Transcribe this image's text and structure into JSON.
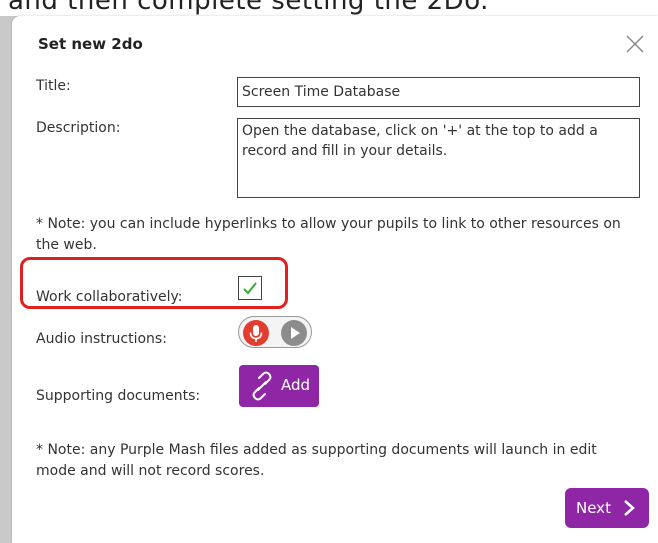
{
  "caption": {
    "text": "and then complete setting the 2Do."
  },
  "dialog": {
    "title": "Set new 2do",
    "close_icon": "close-icon"
  },
  "form": {
    "title_label": "Title:",
    "title_value": "Screen Time Database",
    "description_label": "Description:",
    "description_value": "Open the database, click on '+' at the top to add a record and fill in your details.",
    "hyperlink_note": "* Note: you can include hyperlinks to allow your pupils to link to other resources on the web.",
    "collaborative_label": "Work collaboratively:",
    "collaborative_checked": true,
    "audio_label": "Audio instructions:",
    "audio_icons": [
      "microphone-icon",
      "play-icon"
    ],
    "supporting_label": "Supporting documents:",
    "add_label": "Add",
    "add_icon": "link-icon",
    "documents_note": "* Note: any Purple Mash files added as supporting documents will launch in edit mode and will not record scores."
  },
  "footer": {
    "next_label": "Next",
    "next_icon": "chevron-right-icon"
  },
  "colors": {
    "accent": "#8e26a6",
    "highlight": "#e02020",
    "check": "#3aa835",
    "record": "#e33d2f",
    "play": "#8c8c8c"
  }
}
